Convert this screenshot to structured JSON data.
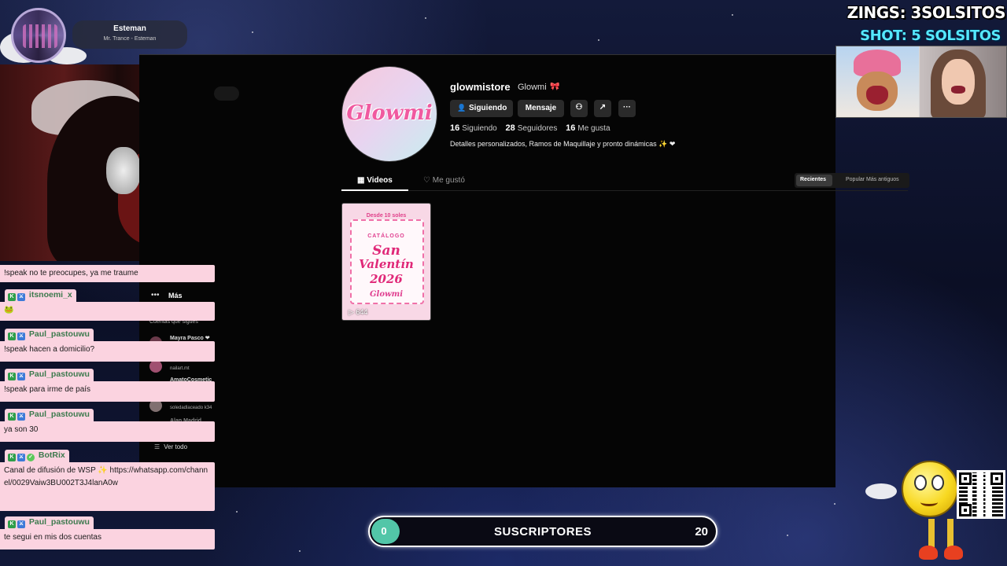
{
  "overlay": {
    "zings_text": "ZINGS: 3SOLSITOS",
    "shot_text": "SHOT: 5 SOLSITOS",
    "streamer": {
      "name": "Esteman",
      "now_playing": "Mr. Trance - Esteman"
    },
    "subs": {
      "current": "0",
      "label": "SUSCRIPTORES",
      "goal": "20",
      "progress_fraction": 0.0
    }
  },
  "tiktok": {
    "sidebar": {
      "more_label": "Más",
      "following_title": "Cuentas que sigues",
      "following": [
        {
          "name": "Mayra Pasco ❤",
          "handle": ""
        },
        {
          "name": "",
          "handle": "nailart.mt"
        },
        {
          "name": "AmatoCosmetic",
          "handle": ""
        },
        {
          "name": "",
          "handle": "soledadlaceado k34"
        },
        {
          "name": "Alan Madrid",
          "handle": ""
        }
      ],
      "see_all_label": "Ver todo"
    },
    "profile": {
      "avatar_text": "Glowmi",
      "username": "glowmistore",
      "display_name": "Glowmi",
      "following_button": "Siguiendo",
      "message_button": "Mensaje",
      "stats": {
        "following_count": "16",
        "following_label": "Siguiendo",
        "followers_count": "28",
        "followers_label": "Seguidores",
        "likes_count": "16",
        "likes_label": "Me gusta"
      },
      "bio": "Detalles personalizados, Ramos de Maquillaje y pronto dinámicas ✨ ❤"
    },
    "tabs": {
      "videos": "Videos",
      "liked": "Me gustó"
    },
    "sort": {
      "recent": "Recientes",
      "popular": "Popular",
      "oldest": "Más antiguos"
    },
    "videos": [
      {
        "top_text": "Desde 10 soles",
        "catalog_label": "CATÁLOGO",
        "line1": "San",
        "line2": "Valentín",
        "line3": "2026",
        "brand": "Glowmi",
        "views": "644"
      }
    ]
  },
  "chat": {
    "messages": [
      {
        "user": "",
        "text": "!speak no te preocupes, ya me traume"
      },
      {
        "user": "itsnoemi_x",
        "text": "🐸"
      },
      {
        "user": "Paul_pastouwu",
        "text": "!speak hacen a domicilio?"
      },
      {
        "user": "Paul_pastouwu",
        "text": "!speak para irme de país"
      },
      {
        "user": "Paul_pastouwu",
        "text": "ya son 30"
      },
      {
        "user": "BotRix",
        "text": "Canal de difusión de WSP ✨ https://whatsapp.com/channel/0029Vaiw3BU002T3J4lanA0w"
      },
      {
        "user": "Paul_pastouwu",
        "text": "te segui en mis dos cuentas"
      }
    ]
  },
  "colors": {
    "chat_bg": "#fbd3e0",
    "chat_user": "#3d7a4e",
    "subs_fill": "#52c6a8",
    "shot_text": "#55e8ff",
    "tiktok_bg": "#050505"
  }
}
